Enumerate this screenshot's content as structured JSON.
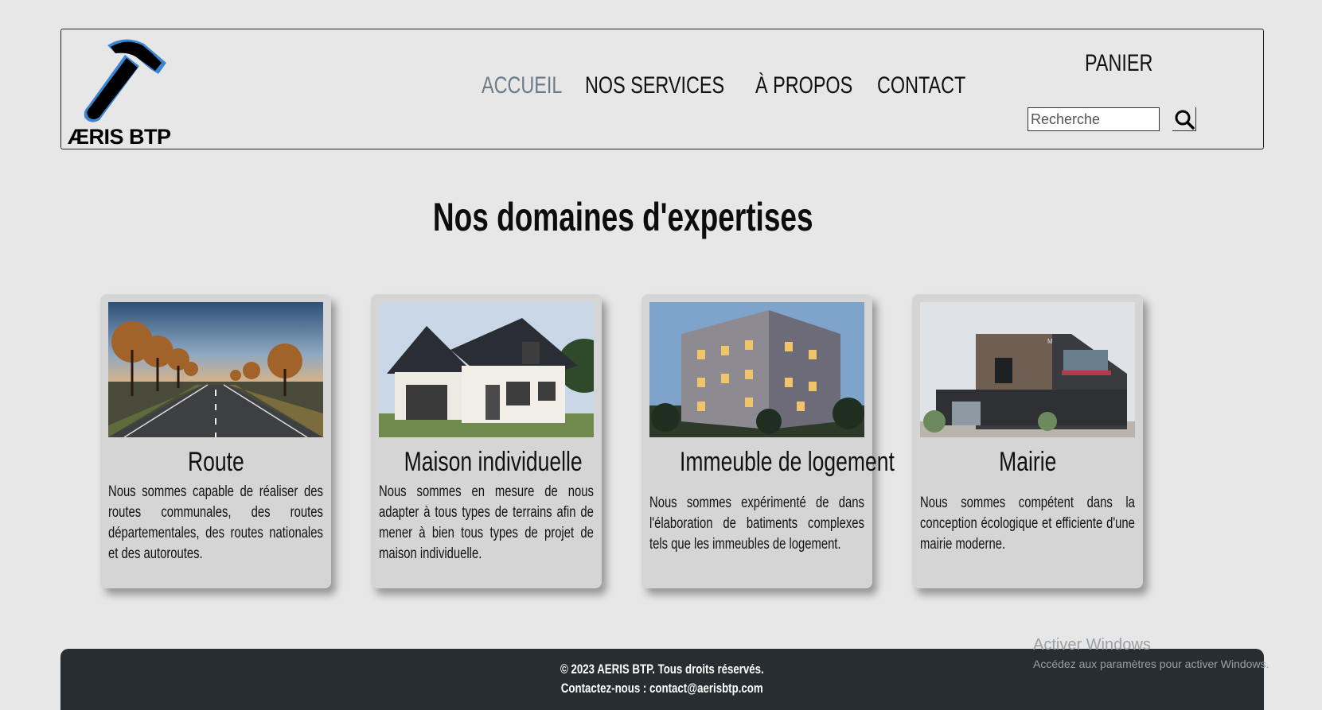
{
  "brand": {
    "logo_text": "ÆRIS BTP"
  },
  "nav": {
    "items": [
      {
        "label": "ACCUEIL",
        "active": true
      },
      {
        "label": "NOS SERVICES",
        "active": false
      },
      {
        "label": "À PROPOS",
        "active": false
      },
      {
        "label": "CONTACT",
        "active": false
      }
    ]
  },
  "header": {
    "cart_label": "PANIER",
    "search_placeholder": "Recherche",
    "search_icon": "magnifier-icon"
  },
  "main": {
    "title": "Nos domaines d'expertises",
    "cards": [
      {
        "title": "Route",
        "image": "road-photo",
        "text": "Nous sommes capable de réaliser des routes communales, des routes départementales, des routes nationales et des autoroutes."
      },
      {
        "title": "Maison individuelle",
        "image": "house-photo",
        "text": "Nous sommes en mesure de nous adapter à tous types de terrains afin de mener à bien tous types de projet de maison individuelle."
      },
      {
        "title": "Immeuble de logement",
        "image": "apartment-building-photo",
        "text": "Nous sommes expérimenté de dans l'élaboration de batiments complexes tels que les immeubles de logement."
      },
      {
        "title": "Mairie",
        "image": "town-hall-photo",
        "text": "Nous sommes compétent dans la conception écologique et efficiente d'une mairie moderne."
      }
    ]
  },
  "footer": {
    "copyright": "© 2023 AERIS BTP. Tous droits réservés.",
    "contact": "Contactez-nous : contact@aerisbtp.com"
  },
  "watermark": {
    "title": "Activer Windows",
    "subtitle": "Accédez aux paramètres pour activer Windows."
  },
  "colors": {
    "background": "#e7e7e7",
    "nav_active": "#6d7b87",
    "card_bg": "#d5d5d5",
    "footer_bg": "#272d31",
    "logo_accent": "#3a86d4"
  }
}
